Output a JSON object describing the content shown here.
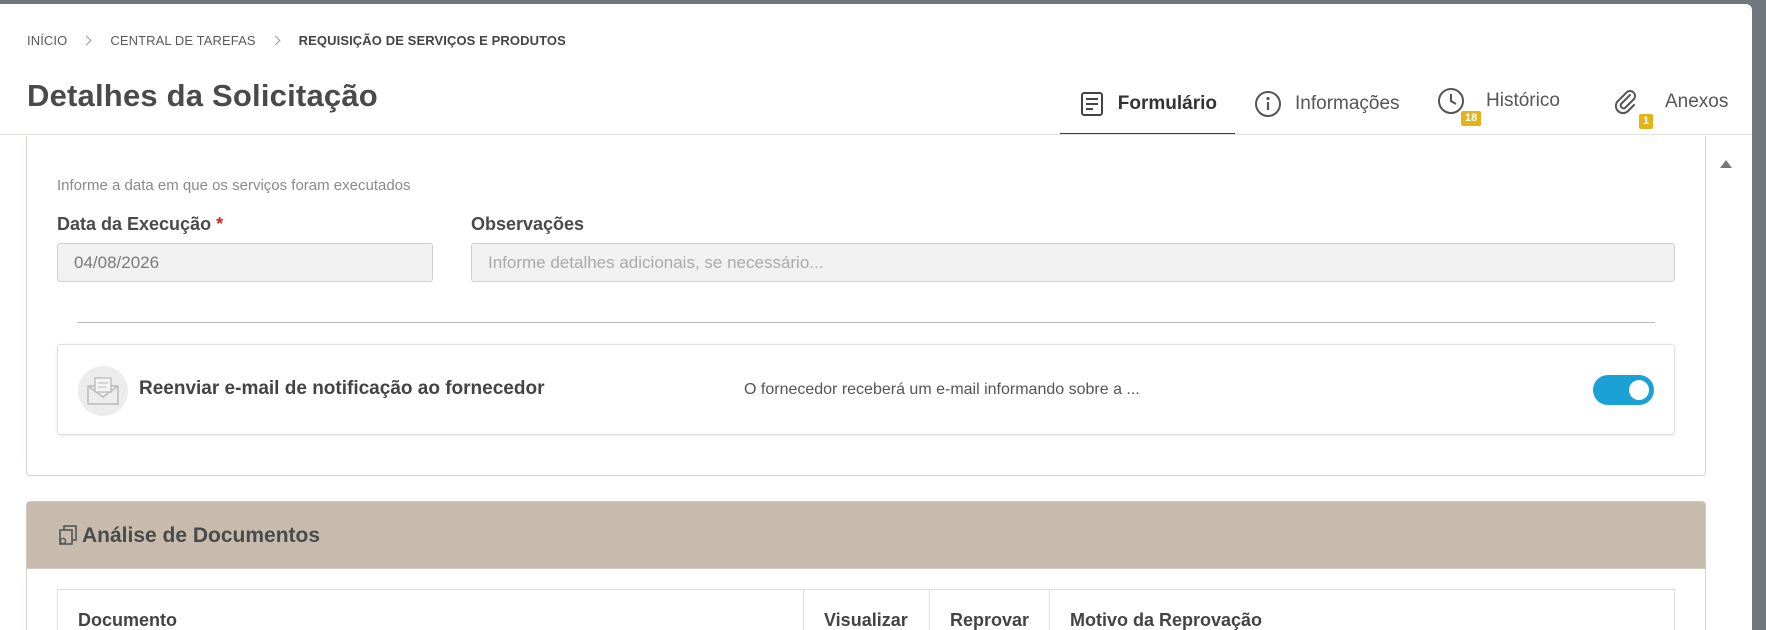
{
  "breadcrumb": {
    "items": [
      "INÍCIO",
      "CENTRAL DE TAREFAS"
    ],
    "current": "REQUISIÇÃO DE SERVIÇOS E PRODUTOS"
  },
  "page": {
    "title": "Detalhes da Solicitação"
  },
  "tabs": [
    {
      "label": "Formulário",
      "icon": "form-icon",
      "active": true
    },
    {
      "label": "Informações",
      "icon": "info-icon"
    },
    {
      "label": "Histórico",
      "icon": "clock-icon",
      "badge": "18"
    },
    {
      "label": "Anexos",
      "icon": "paperclip-icon",
      "badge": "1"
    }
  ],
  "form": {
    "hint": "Informe a data em que os serviços foram executados",
    "execution_date": {
      "label": "Data da Execução",
      "required_mark": "*",
      "value": "04/08/2026"
    },
    "observations": {
      "label": "Observações",
      "placeholder": "Informe detalhes adicionais, se necessário..."
    }
  },
  "notify": {
    "icon": "envelope-icon",
    "title": "Reenviar e-mail de notificação ao fornecedor",
    "description": "O fornecedor receberá um e-mail informando sobre a ...",
    "toggle_on": true,
    "toggle_color": "#1ba1d6"
  },
  "documents": {
    "icon": "documents-icon",
    "title": "Análise de Documentos",
    "columns": [
      "Documento",
      "Visualizar",
      "Reprovar",
      "Motivo da Reprovação"
    ]
  }
}
